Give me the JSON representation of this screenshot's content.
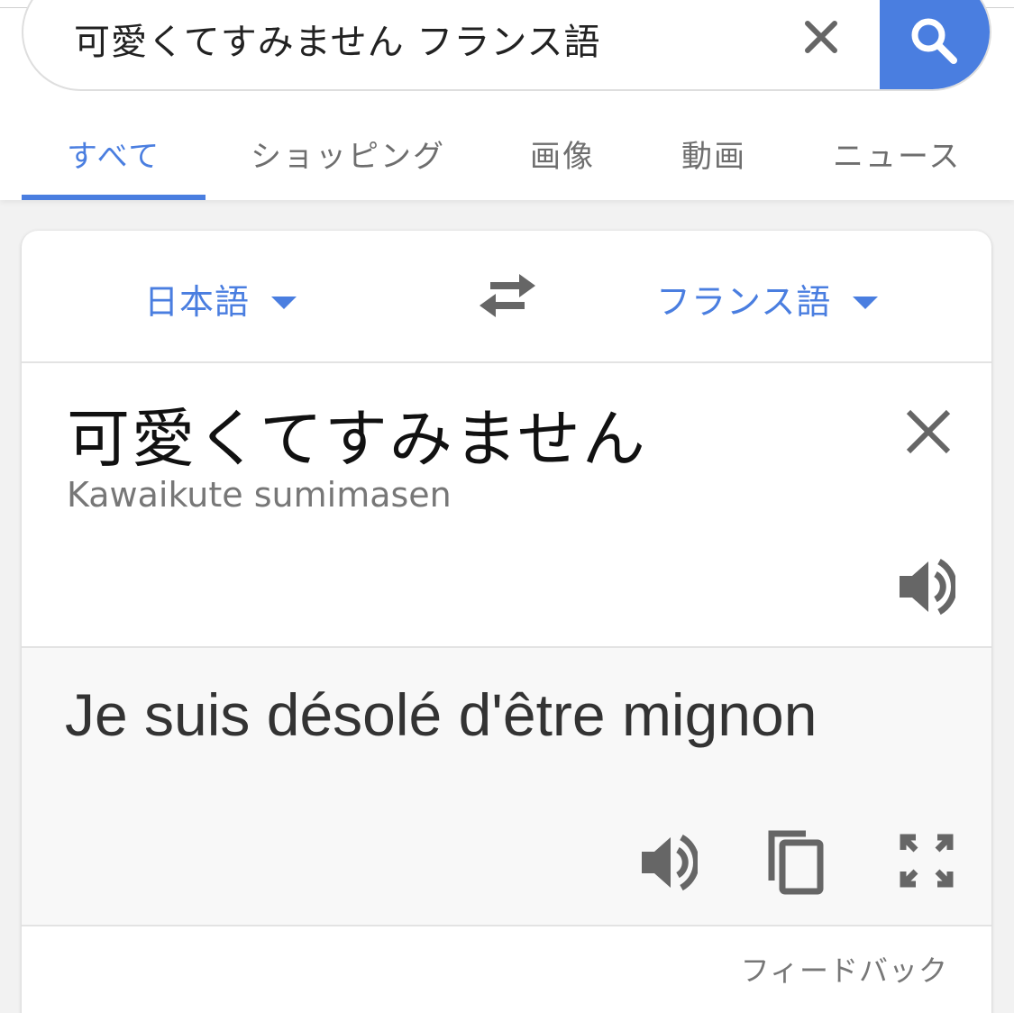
{
  "search": {
    "query": "可愛くてすみません フランス語",
    "clear_icon": "close-icon",
    "search_icon": "search-icon"
  },
  "tabs": [
    {
      "label": "すべて",
      "active": true
    },
    {
      "label": "ショッピング",
      "active": false
    },
    {
      "label": "画像",
      "active": false
    },
    {
      "label": "動画",
      "active": false
    },
    {
      "label": "ニュース",
      "active": false
    }
  ],
  "translator": {
    "source_lang": "日本語",
    "target_lang": "フランス語",
    "source_text": "可愛くてすみません",
    "romanization": "Kawaikute sumimasen",
    "result_text": "Je suis désolé d'être mignon",
    "feedback": "フィードバック"
  },
  "colors": {
    "accent": "#4a7ee0",
    "icon_gray": "#666666",
    "result_bg": "#f8f8f8"
  }
}
